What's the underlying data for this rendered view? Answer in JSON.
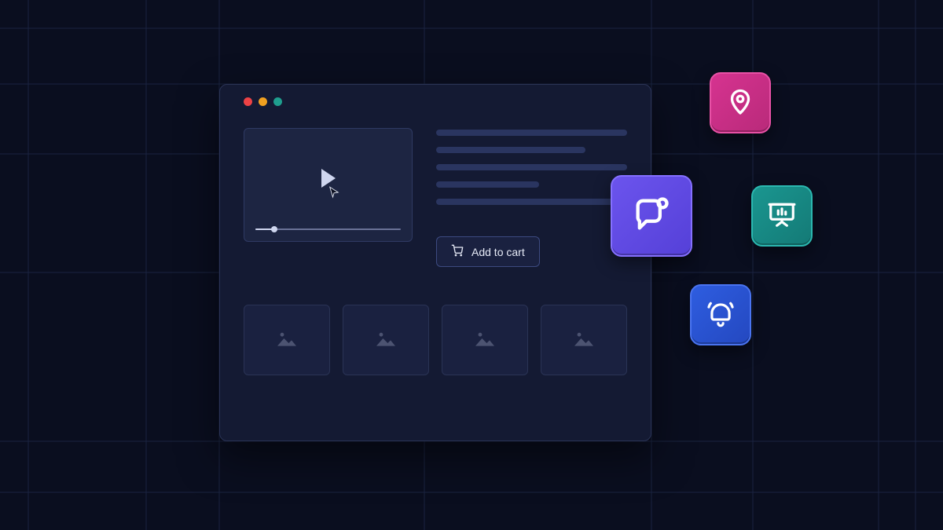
{
  "window": {
    "traffic_lights": [
      "close",
      "minimize",
      "zoom"
    ]
  },
  "product": {
    "add_to_cart_label": "Add to cart",
    "thumbnail_count": 4,
    "video_progress_percent": 12
  },
  "floating_icons": {
    "chat": "chat-icon",
    "location": "map-pin-icon",
    "presentation": "presentation-chart-icon",
    "bell": "bell-icon"
  }
}
